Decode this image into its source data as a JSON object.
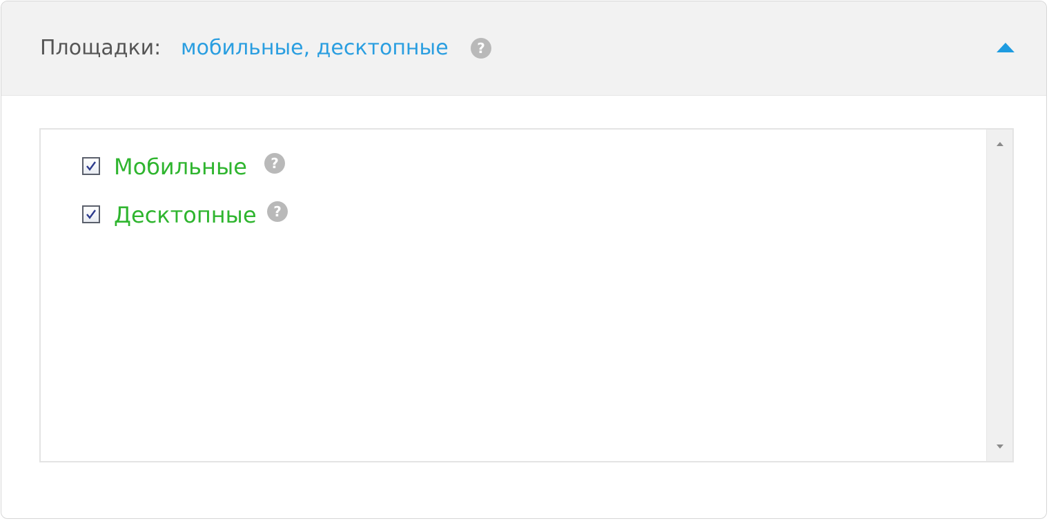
{
  "header": {
    "label": "Площадки:",
    "value": "мобильные, десктопные",
    "help_glyph": "?",
    "help_icon": "question-circle-icon",
    "collapse_icon": "triangle-up-icon"
  },
  "platforms": {
    "items": [
      {
        "label": "Мобильные",
        "checked": true,
        "help_glyph": "?"
      },
      {
        "label": "Десктопные",
        "checked": true,
        "help_glyph": "?"
      }
    ]
  },
  "scrollbar": {
    "up_icon": "scroll-up-arrow-icon",
    "down_icon": "scroll-down-arrow-icon"
  },
  "colors": {
    "accent_blue": "#2a9ee0",
    "item_green": "#2fb52f",
    "header_bg": "#f2f2f2",
    "help_grey": "#b9b9b9"
  }
}
